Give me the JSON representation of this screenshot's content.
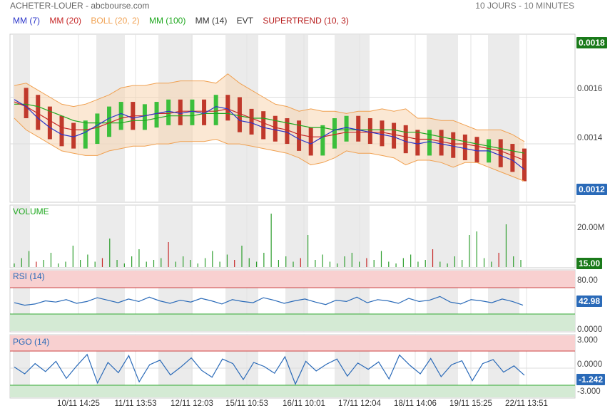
{
  "header": {
    "title": "ACHETER-LOUER - abcbourse.com",
    "period": "10 JOURS - 10 MINUTES"
  },
  "legend": [
    {
      "label": "MM (7)",
      "color": "#2b35c9"
    },
    {
      "label": "MM (20)",
      "color": "#c62828"
    },
    {
      "label": "BOLL (20, 2)",
      "color": "#f0a050"
    },
    {
      "label": "MM (100)",
      "color": "#1fa81f"
    },
    {
      "label": "MM (14)",
      "color": "#333333"
    },
    {
      "label": "EVT",
      "color": "#333333"
    },
    {
      "label": "SUPERTREND (10, 3)",
      "color": "#b71c1c"
    }
  ],
  "chart_data": [
    {
      "type": "line",
      "panel": "price",
      "x_labels": [
        "10/11 14:25",
        "11/11 13:53",
        "12/11 12:03",
        "15/11 10:53",
        "16/11 10:01",
        "17/11 12:04",
        "18/11 14:06",
        "19/11 15:25",
        "22/11 13:51"
      ],
      "y_ticks": [
        "0.0016",
        "0.0014"
      ],
      "ylim": [
        0.00115,
        0.00187
      ],
      "last_price": "0.0012",
      "high_price": "0.0018",
      "series": [
        {
          "name": "MM (7)",
          "values": [
            0.00159,
            0.00156,
            0.00151,
            0.00147,
            0.00144,
            0.00143,
            0.00145,
            0.00148,
            0.00151,
            0.00153,
            0.00151,
            0.00152,
            0.00153,
            0.00154,
            0.00153,
            0.00154,
            0.00153,
            0.00156,
            0.00155,
            0.0015,
            0.00149,
            0.00147,
            0.00146,
            0.00145,
            0.00142,
            0.0014,
            0.00143,
            0.00146,
            0.00147,
            0.00146,
            0.00145,
            0.00144,
            0.00143,
            0.00141,
            0.0014,
            0.00141,
            0.0014,
            0.00139,
            0.00138,
            0.00137,
            0.00137,
            0.00135,
            0.00133,
            0.00129
          ]
        },
        {
          "name": "MM (20)",
          "values": [
            0.00158,
            0.00156,
            0.00153,
            0.0015,
            0.00147,
            0.00146,
            0.00146,
            0.00147,
            0.00149,
            0.00151,
            0.00152,
            0.00152,
            0.00153,
            0.00153,
            0.00154,
            0.00154,
            0.00154,
            0.00154,
            0.00155,
            0.00153,
            0.00151,
            0.00149,
            0.00147,
            0.00146,
            0.00144,
            0.00143,
            0.00143,
            0.00144,
            0.00145,
            0.00145,
            0.00145,
            0.00145,
            0.00144,
            0.00143,
            0.00142,
            0.00142,
            0.00141,
            0.0014,
            0.0014,
            0.00139,
            0.00138,
            0.00137,
            0.00135,
            0.00133
          ]
        },
        {
          "name": "MM (100)",
          "values": [
            0.00157,
            0.00157,
            0.00156,
            0.00154,
            0.00152,
            0.0015,
            0.00149,
            0.00149,
            0.00149,
            0.00149,
            0.0015,
            0.0015,
            0.00151,
            0.00152,
            0.00152,
            0.00152,
            0.00153,
            0.00153,
            0.00153,
            0.00152,
            0.00151,
            0.00151,
            0.0015,
            0.00149,
            0.00148,
            0.00147,
            0.00147,
            0.00146,
            0.00146,
            0.00146,
            0.00146,
            0.00146,
            0.00146,
            0.00145,
            0.00145,
            0.00144,
            0.00143,
            0.00142,
            0.00141,
            0.0014,
            0.00139,
            0.00138,
            0.00137,
            0.00136
          ]
        },
        {
          "name": "BOLL (20, 2) upper",
          "values": [
            0.00165,
            0.00166,
            0.00163,
            0.0016,
            0.00157,
            0.00156,
            0.00157,
            0.00159,
            0.00161,
            0.00164,
            0.00165,
            0.00165,
            0.00166,
            0.00166,
            0.00167,
            0.00167,
            0.00167,
            0.00166,
            0.0017,
            0.00166,
            0.00163,
            0.0016,
            0.00157,
            0.00156,
            0.00154,
            0.00155,
            0.00154,
            0.00154,
            0.00153,
            0.00154,
            0.00154,
            0.00155,
            0.00154,
            0.00155,
            0.00151,
            0.00151,
            0.0015,
            0.0015,
            0.00148,
            0.00146,
            0.00146,
            0.00146,
            0.00144,
            0.00141
          ]
        },
        {
          "name": "BOLL (20, 2) lower",
          "values": [
            0.00151,
            0.00146,
            0.00143,
            0.0014,
            0.00137,
            0.00136,
            0.00135,
            0.00135,
            0.00137,
            0.00138,
            0.00139,
            0.00139,
            0.0014,
            0.0014,
            0.00141,
            0.00141,
            0.00141,
            0.00142,
            0.0014,
            0.0014,
            0.00139,
            0.00138,
            0.00137,
            0.00136,
            0.00134,
            0.00131,
            0.00132,
            0.00134,
            0.00137,
            0.00136,
            0.00136,
            0.00135,
            0.00134,
            0.00131,
            0.00133,
            0.00133,
            0.00132,
            0.0013,
            0.00132,
            0.00132,
            0.0013,
            0.00128,
            0.00126,
            0.00124
          ]
        }
      ]
    },
    {
      "type": "bar",
      "panel": "volume",
      "title": "VOLUME",
      "y_ticks": [
        "20.00M"
      ],
      "last_value": "15.00",
      "values": [
        2,
        5,
        9,
        3,
        4,
        8,
        2,
        3,
        12,
        4,
        7,
        3,
        5,
        16,
        4,
        2,
        6,
        10,
        3,
        4,
        5,
        14,
        3,
        6,
        4,
        2,
        5,
        9,
        3,
        7,
        4,
        12,
        5,
        3,
        8,
        30,
        4,
        6,
        3,
        5,
        18,
        4,
        7,
        3,
        2,
        6,
        8,
        3,
        5,
        4,
        9,
        3,
        2,
        5,
        7,
        3,
        4,
        10,
        3,
        2,
        6,
        4,
        18,
        20,
        5,
        3,
        8,
        24,
        6,
        4
      ]
    },
    {
      "type": "line",
      "panel": "rsi",
      "title": "RSI (14)",
      "y_ticks": [
        "80.00",
        "0.0000"
      ],
      "last_value": "42.98",
      "values": [
        47,
        43,
        45,
        50,
        48,
        52,
        46,
        49,
        55,
        51,
        47,
        53,
        49,
        56,
        50,
        46,
        51,
        48,
        54,
        50,
        45,
        52,
        49,
        47,
        55,
        51,
        46,
        50,
        53,
        48,
        44,
        51,
        49,
        56,
        47,
        52,
        50,
        46,
        54,
        49,
        51,
        57,
        48,
        45,
        52,
        50,
        47,
        53,
        49,
        43
      ]
    },
    {
      "type": "line",
      "panel": "pgo",
      "title": "PGO (14)",
      "y_ticks": [
        "3.000",
        "0.0000",
        "-3.000"
      ],
      "last_value": "-1.242",
      "values": [
        0.2,
        -1.0,
        0.8,
        -0.6,
        1.2,
        -1.8,
        0.4,
        2.4,
        -2.6,
        1.0,
        -0.8,
        2.2,
        -2.4,
        0.6,
        1.4,
        -1.2,
        0.2,
        1.8,
        -0.4,
        -1.6,
        1.6,
        0.8,
        -2.0,
        1.0,
        0.3,
        -0.9,
        2.0,
        -2.8,
        1.2,
        -0.5,
        0.7,
        1.6,
        -1.4,
        0.9,
        -0.2,
        1.1,
        -1.9,
        2.3,
        0.5,
        -1.0,
        1.7,
        -1.5,
        0.6,
        1.3,
        -2.2,
        0.8,
        1.5,
        -0.7,
        0.4,
        -1.24
      ]
    }
  ],
  "sidebar_badges": {
    "price_high": "0.0018",
    "price_last": "0.0012",
    "vol_last": "15.00",
    "rsi_last": "42.98",
    "pgo_last": "-1.242"
  },
  "colors": {
    "ma7": "#2b35c9",
    "ma20": "#c62828",
    "boll": "#f0a050",
    "ma100": "#1fa81f",
    "supertrend": "#b71c1c",
    "volume": "#2e9e2e",
    "rsi": "#2a6ab8",
    "pgo": "#2a6ab8",
    "green_badge": "#1a7a1a",
    "blue_badge": "#2a6ab8"
  }
}
